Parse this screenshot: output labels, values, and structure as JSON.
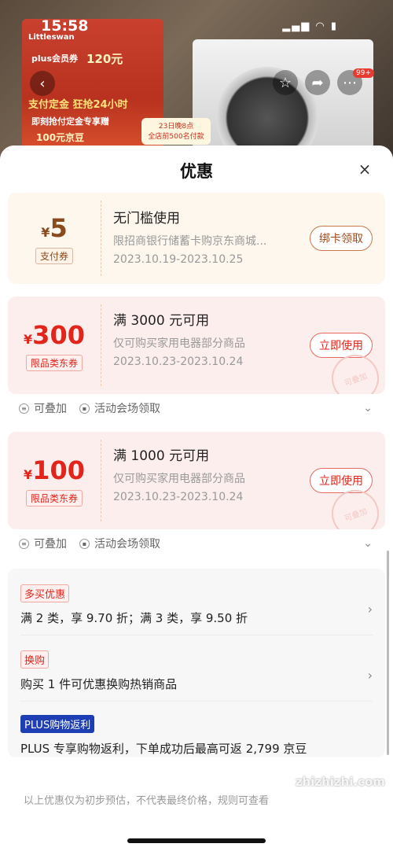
{
  "status": {
    "time": "15:58",
    "icons": "▂▄▆ ◠ ▮"
  },
  "photo": {
    "brand": "Littleswan",
    "banner_lines": [
      "plus会员券",
      "支付定金 狂抢24小时",
      "即刻抢付定金专享赠",
      "100元京豆"
    ],
    "promo_price": "120元",
    "promo_pill_line1": "23日晚8点",
    "promo_pill_line2": "全店前500名付款",
    "cart_badge": "99+"
  },
  "sheet": {
    "title": "优惠",
    "close": "×"
  },
  "coupons": [
    {
      "currency": "¥",
      "amount": "5",
      "tag": "支付券",
      "condition": "无门槛使用",
      "desc": "限招商银行储蓄卡购京东商城...",
      "date": "2023.10.19-2023.10.25",
      "button": "绑卡领取"
    },
    {
      "currency": "¥",
      "amount": "300",
      "tag": "限品类东券",
      "condition": "满 3000 元可用",
      "desc": "仅可购买家用电器部分商品",
      "date": "2023.10.23-2023.10.24",
      "button": "立即使用",
      "stamp": "可叠加",
      "foot_stack": "可叠加",
      "foot_source": "活动会场领取"
    },
    {
      "currency": "¥",
      "amount": "100",
      "tag": "限品类东券",
      "condition": "满 1000 元可用",
      "desc": "仅可购买家用电器部分商品",
      "date": "2023.10.23-2023.10.24",
      "button": "立即使用",
      "stamp": "可叠加",
      "foot_stack": "可叠加",
      "foot_source": "活动会场领取"
    }
  ],
  "offers": [
    {
      "tag": "多买优惠",
      "text": "满 2 类，享 9.70 折；满 3 类，享 9.50 折"
    },
    {
      "tag": "换购",
      "text": "购买 1 件可优惠换购热销商品"
    },
    {
      "tag": "PLUS购物返利",
      "text": "PLUS 专享购物返利，下单成功后最高可返 2,799 京豆"
    }
  ],
  "disclaimer": "以上优惠仅为初步预估，不代表最终价格，规则可查看",
  "watermark": "zhizhizhi.com",
  "colors": {
    "accent_red": "#e1251b",
    "brown": "#8b4a1e",
    "plus_blue": "#1e3fb3"
  }
}
